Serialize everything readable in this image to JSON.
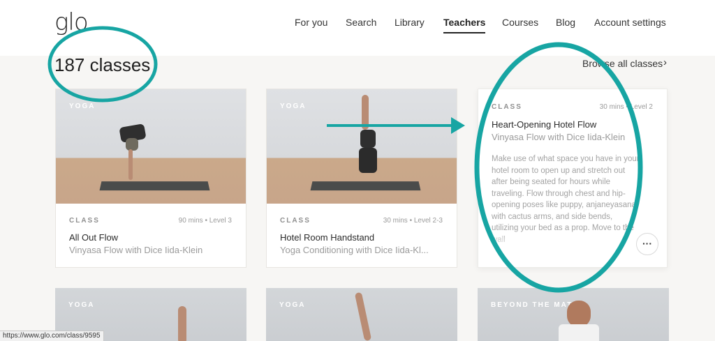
{
  "header": {
    "logo": "glo",
    "nav": [
      {
        "label": "For you"
      },
      {
        "label": "Search"
      },
      {
        "label": "Library"
      },
      {
        "label": "Teachers"
      },
      {
        "label": "Courses"
      },
      {
        "label": "Blog"
      },
      {
        "label": "Account settings"
      }
    ],
    "active_nav": "Teachers"
  },
  "summary": {
    "count_label": "187 classes",
    "browse_label": "Browse all classes",
    "browse_chevron": "›"
  },
  "cards": [
    {
      "tag": "YOGA",
      "kind": "CLASS",
      "info": "90 mins • Level 3",
      "title": "All Out Flow",
      "subtitle": "Vinyasa Flow with Dice Iida-Klein"
    },
    {
      "tag": "YOGA",
      "kind": "CLASS",
      "info": "30 mins • Level 2-3",
      "title": "Hotel Room Handstand",
      "subtitle": "Yoga Conditioning with Dice Iida-Kl..."
    }
  ],
  "hover_card": {
    "kind": "CLASS",
    "info": "30 mins • Level 2",
    "title": "Heart-Opening Hotel Flow",
    "subtitle": "Vinyasa Flow with Dice Iida-Klein",
    "description": "Make use of what space you have in your hotel room to open up and stretch out after being seated for hours while traveling. Flow through chest and hip-opening poses like puppy, anjaneyasana with cactus arms, and side bends, utilizing your bed as a prop. Move to the wall",
    "more_icon": "more-horizontal-icon",
    "more_glyph": "···"
  },
  "row2_tags": [
    "YOGA",
    "YOGA",
    "BEYOND THE MAT"
  ],
  "status_bar": {
    "url": "https://www.glo.com/class/9595"
  },
  "annotation_color": "#17a5a3"
}
